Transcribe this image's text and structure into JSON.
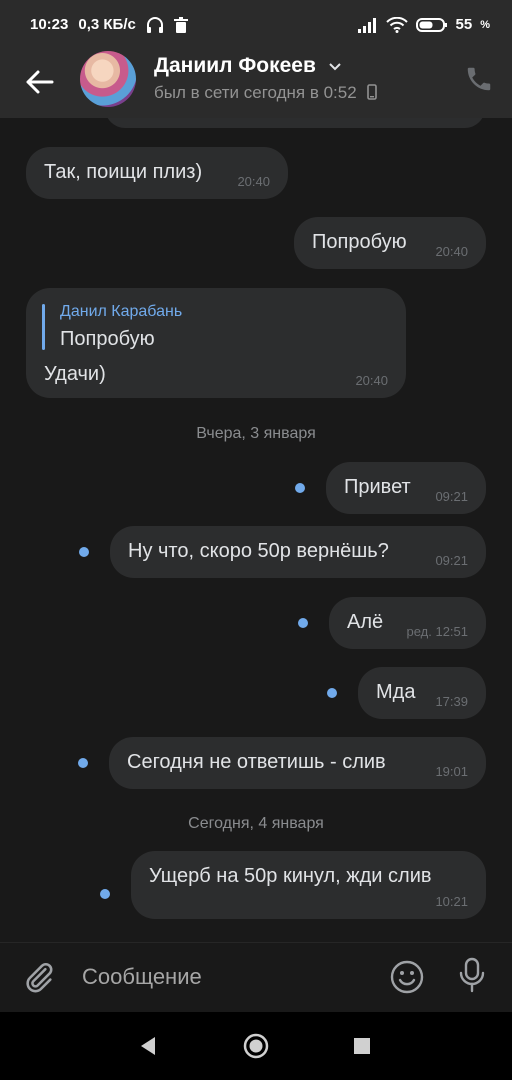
{
  "status_bar": {
    "time": "10:23",
    "net_speed": "0,3 КБ/с",
    "battery": "55",
    "battery_unit": "%"
  },
  "header": {
    "contact_name": "Даниил Фокеев",
    "last_seen": "был в сети сегодня в 0:52"
  },
  "messages": [
    {
      "text": "Так, поищи плиз)",
      "time": "20:40",
      "side": "in"
    },
    {
      "text": "Попробую",
      "time": "20:40",
      "side": "out"
    },
    {
      "reply_author": "Данил Карабань",
      "reply_text": "Попробую",
      "text": "Удачи)",
      "time": "20:40",
      "side": "in"
    },
    {
      "date_separator": "Вчера, 3 января"
    },
    {
      "text": "Привет",
      "time": "09:21",
      "side": "out",
      "unread": true
    },
    {
      "text": "Ну что, скоро 50р вернёшь?",
      "time": "09:21",
      "side": "out",
      "unread": true
    },
    {
      "text": "Алё",
      "time": "ред. 12:51",
      "side": "out",
      "unread": true
    },
    {
      "text": "Мда",
      "time": "17:39",
      "side": "out",
      "unread": true
    },
    {
      "text": "Сегодня не ответишь - слив",
      "time": "19:01",
      "side": "out",
      "unread": true
    },
    {
      "date_separator": "Сегодня, 4 января"
    },
    {
      "text": "Ущерб на 50р кинул, жди слив",
      "time": "10:21",
      "side": "out",
      "unread": true
    }
  ],
  "composer": {
    "placeholder": "Сообщение"
  },
  "icons": {
    "back": "arrow-left-icon",
    "call": "phone-icon",
    "attach": "paperclip-icon",
    "emoji": "smile-icon",
    "voice": "microphone-icon"
  },
  "colors": {
    "accent": "#71aaeb",
    "bubble": "#2c2d2e",
    "background": "#191919"
  }
}
